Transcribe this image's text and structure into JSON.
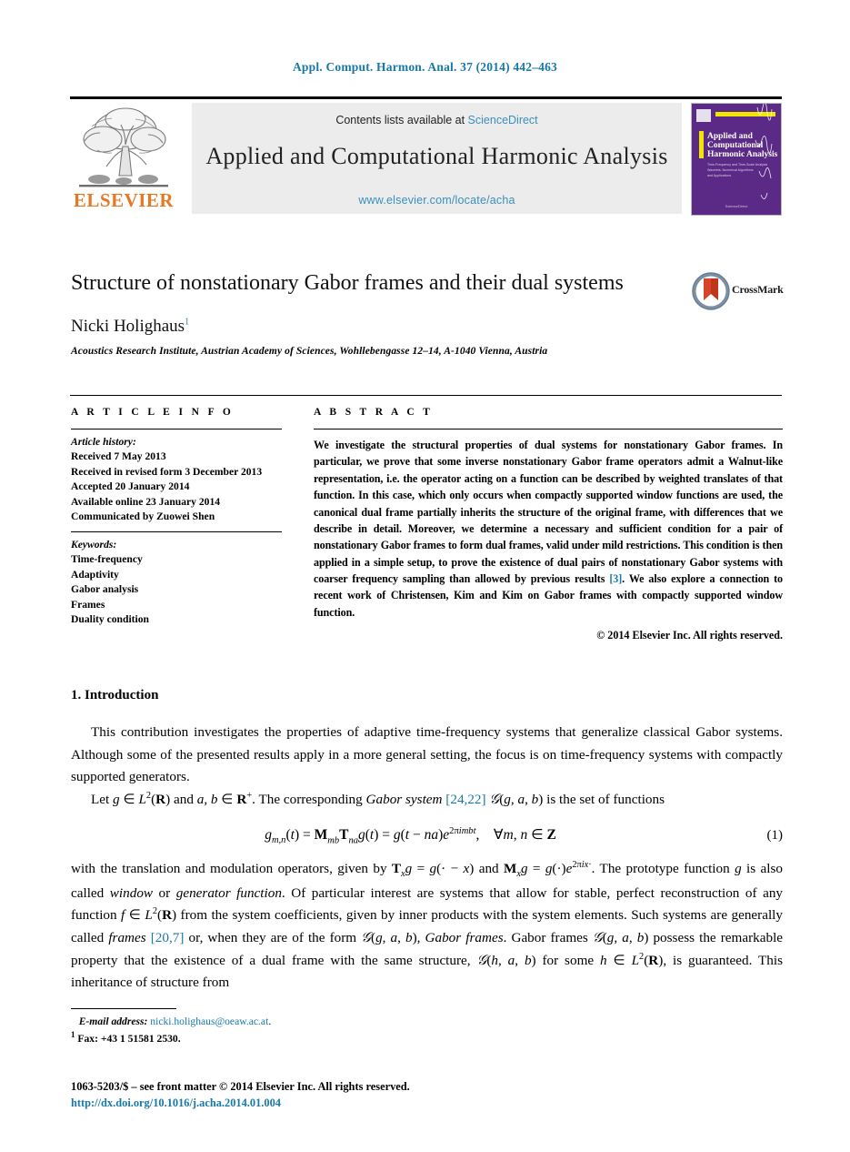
{
  "journal_ref": "Appl. Comput. Harmon. Anal. 37 (2014) 442–463",
  "masthead": {
    "publisher_name": "ELSEVIER",
    "contents_prefix": "Contents lists available at ",
    "contents_link": "ScienceDirect",
    "journal_title": "Applied and Computational Harmonic Analysis",
    "journal_url": "www.elsevier.com/locate/acha",
    "cover": {
      "line1": "Applied and",
      "line2": "Computational",
      "line3": "Harmonic Analysis",
      "bg_color": "#5b2a86",
      "bar_color": "#f2e600"
    }
  },
  "article": {
    "title": "Structure of nonstationary Gabor frames and their dual systems",
    "crossmark_label": "CrossMark",
    "author": "Nicki Holighaus",
    "author_footnote_marker": "1",
    "affiliation": "Acoustics Research Institute, Austrian Academy of Sciences, Wohllebengasse 12–14, A-1040 Vienna, Austria"
  },
  "info": {
    "section_label": "A R T I C L E   I N F O",
    "history_heading": "Article history:",
    "history": [
      "Received 7 May 2013",
      "Received in revised form 3 December 2013",
      "Accepted 20 January 2014",
      "Available online 23 January 2014",
      "Communicated by Zuowei Shen"
    ],
    "keywords_heading": "Keywords:",
    "keywords": [
      "Time-frequency",
      "Adaptivity",
      "Gabor analysis",
      "Frames",
      "Duality condition"
    ]
  },
  "abstract": {
    "section_label": "A B S T R A C T",
    "part1": "We investigate the structural properties of dual systems for nonstationary Gabor frames. In particular, we prove that some inverse nonstationary Gabor frame operators admit a Walnut-like representation, i.e. the operator acting on a function can be described by weighted translates of that function. In this case, which only occurs when compactly supported window functions are used, the canonical dual frame partially inherits the structure of the original frame, with differences that we describe in detail. Moreover, we determine a necessary and sufficient condition for a pair of nonstationary Gabor frames to form dual frames, valid under mild restrictions. This condition is then applied in a simple setup, to prove the existence of dual pairs of nonstationary Gabor systems with coarser frequency sampling than allowed by previous results ",
    "citation": "[3]",
    "part2": ". We also explore a connection to recent work of Christensen, Kim and Kim on Gabor frames with compactly supported window function.",
    "copyright": "© 2014 Elsevier Inc. All rights reserved."
  },
  "body": {
    "section_heading": "1. Introduction",
    "para1": "This contribution investigates the properties of adaptive time-frequency systems that generalize classical Gabor systems. Although some of the presented results apply in a more general setting, the focus is on time-frequency systems with compactly supported generators.",
    "para2_a": "Let ",
    "para2_b": " and ",
    "para2_c": ". The corresponding ",
    "para2_italic": "Gabor system",
    "para2_cite": "[24,22]",
    "para2_d": " is the set of functions",
    "equation_number": "(1)",
    "para3_a": "with the translation and modulation operators, given by ",
    "para3_b": " and ",
    "para3_c": ". The prototype function ",
    "para3_d": " is also called ",
    "para3_italic1": "window",
    "para3_e": " or ",
    "para3_italic2": "generator function",
    "para3_f": ". Of particular interest are systems that allow for stable, perfect reconstruction of any function ",
    "para3_g": " from the system coefficients, given by inner products with the system elements. Such systems are generally called ",
    "para3_italic3": "frames",
    "para3_cite": "[20,7]",
    "para3_h": " or, when they are of the form ",
    "para3_i": ", ",
    "para3_italic4": "Gabor frames",
    "para3_j": ". Gabor frames ",
    "para3_k": " possess the remarkable property that the existence of a dual frame with the same structure, ",
    "para3_l": " for some ",
    "para3_m": ", is guaranteed. This inheritance of structure from"
  },
  "footer": {
    "email_label": "E-mail address:",
    "email": "nicki.holighaus@oeaw.ac.at",
    "email_period": ".",
    "fax_marker": "1",
    "fax": "Fax: +43 1 51581 2530.",
    "imprint": "1063-5203/$ – see front matter  © 2014 Elsevier Inc. All rights reserved.",
    "doi": "http://dx.doi.org/10.1016/j.acha.2014.01.004"
  },
  "colors": {
    "link_blue": "#1878a8",
    "sciencedirect_blue": "#3a8fbd",
    "elsevier_orange": "#e87722",
    "masthead_gray": "#ececec"
  }
}
